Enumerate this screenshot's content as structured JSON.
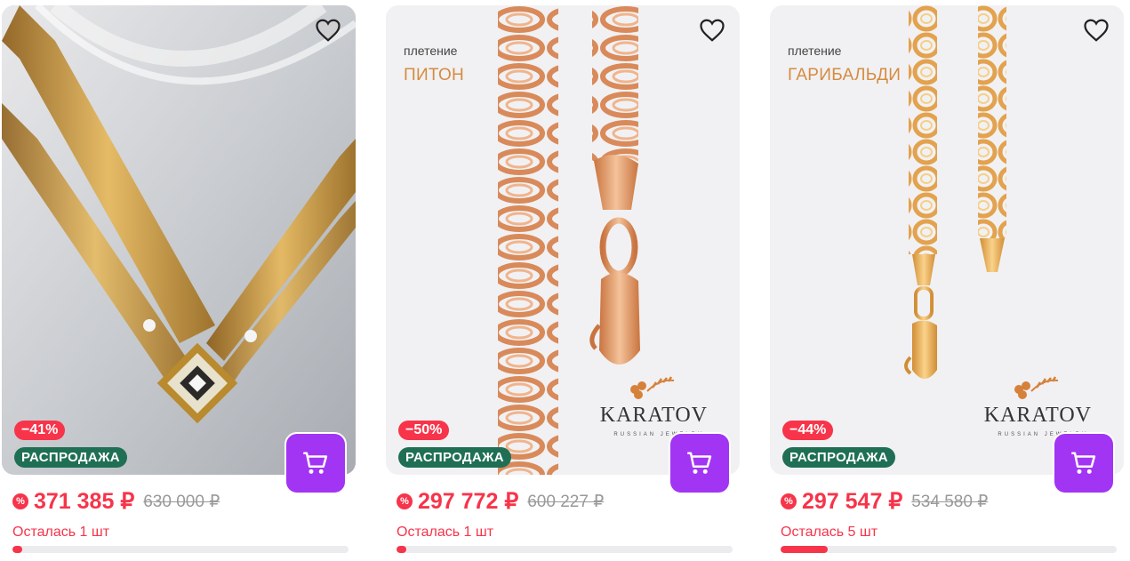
{
  "products": [
    {
      "discount": "−41%",
      "sale_label": "РАСПРОДАЖА",
      "price": "371 385 ₽",
      "old_price": "630 000 ₽",
      "stock_text": "Осталась 1 шт",
      "stock_fraction": 0.03,
      "image_icon": "gold-necklace-photo",
      "favorite_icon": "heart-icon",
      "cart_icon": "cart-icon"
    },
    {
      "weave_label": "плетение",
      "weave_name": "ПИТОН",
      "brand": "KARATOV",
      "brand_sub": "RUSSIAN JEWELRY",
      "discount": "−50%",
      "sale_label": "РАСПРОДАЖА",
      "price": "297 772 ₽",
      "old_price": "600 227 ₽",
      "stock_text": "Осталась 1 шт",
      "stock_fraction": 0.03,
      "image_icon": "gold-chain-photo",
      "favorite_icon": "heart-icon",
      "cart_icon": "cart-icon"
    },
    {
      "weave_label": "плетение",
      "weave_name": "ГАРИБАЛЬДИ",
      "brand": "KARATOV",
      "brand_sub": "RUSSIAN JEWELRY",
      "discount": "−44%",
      "sale_label": "РАСПРОДАЖА",
      "price": "297 547 ₽",
      "old_price": "534 580 ₽",
      "stock_text": "Осталась 5 шт",
      "stock_fraction": 0.14,
      "image_icon": "gold-chain-photo",
      "favorite_icon": "heart-icon",
      "cart_icon": "cart-icon"
    }
  ],
  "colors": {
    "accent_red": "#f7344a",
    "sale_green": "#1f6f55",
    "cart_purple": "#a234f3",
    "weave_gold": "#d68b3f"
  }
}
